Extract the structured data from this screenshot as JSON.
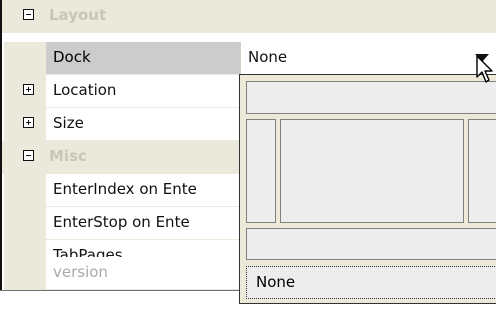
{
  "categories": [
    {
      "label": "Layout"
    },
    {
      "label": "Misc"
    }
  ],
  "properties": {
    "dock": {
      "name": "Dock",
      "value": "None"
    },
    "location": {
      "name": "Location"
    },
    "size": {
      "name": "Size"
    },
    "enter_index": {
      "name": "EnterIndex on Ente"
    },
    "enter_stop": {
      "name": "EnterStop on Ente"
    },
    "tab_pages": {
      "name": "TabPages"
    },
    "version": {
      "name": "version"
    }
  },
  "dock_picker": {
    "none_label": "None"
  },
  "colors": {
    "category_background": "#ebe9db",
    "selected_row": "#cccccc",
    "disabled_text": "#a9a9a9",
    "picker_background": "#ece9d8"
  },
  "icons": {
    "expand": "plus-box-icon",
    "collapse": "minus-box-icon",
    "dropdown": "chevron-down-icon",
    "cursor": "cursor-icon"
  }
}
